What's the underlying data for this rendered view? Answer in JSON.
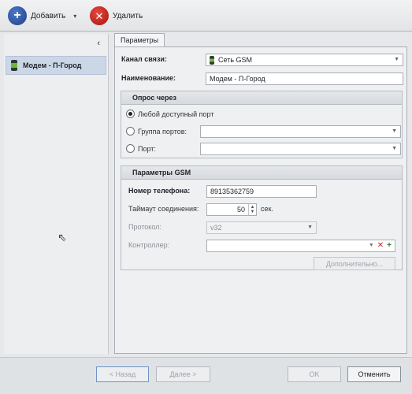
{
  "toolbar": {
    "add_label": "Добавить",
    "delete_label": "Удалить",
    "caret": "▾"
  },
  "sidebar": {
    "collapse_glyph": "‹",
    "items": [
      {
        "label": "Модем - П-Город",
        "selected": true
      }
    ]
  },
  "tab": {
    "label": "Параметры"
  },
  "form": {
    "channel_label": "Канал связи:",
    "channel_value": "Сеть GSM",
    "name_label": "Наименование:",
    "name_value": "Модем - П-Город"
  },
  "poll_group": {
    "title": "Опрос через",
    "options": [
      {
        "label": "Любой доступный порт",
        "selected": true
      },
      {
        "label": "Группа портов:",
        "selected": false
      },
      {
        "label": "Порт:",
        "selected": false
      }
    ]
  },
  "gsm_group": {
    "title": "Параметры GSM",
    "phone_label": "Номер телефона:",
    "phone_value": "89135362759",
    "timeout_label": "Таймаут соединения:",
    "timeout_value": "50",
    "timeout_unit": "сек.",
    "protocol_label": "Протокол:",
    "protocol_value": "v32",
    "controller_label": "Контроллер:",
    "controller_value": "",
    "advanced_button": "Дополнительно..."
  },
  "footer": {
    "back": "< Назад",
    "next": "Далее >",
    "ok": "OK",
    "cancel": "Отменить"
  },
  "colors": {
    "add_icon": "#2a4f9e",
    "delete_icon": "#c4211a",
    "selection": "#cbd7e6",
    "gsm_icon": "#6fb83d",
    "controller_clear": "#c62828",
    "controller_add": "#2e7d32"
  },
  "icons": {
    "add": "plus-circle-icon",
    "delete": "x-circle-icon",
    "device": "gsm-modem-icon",
    "collapse": "chevron-left-icon",
    "dropdown": "chevron-down-icon"
  }
}
